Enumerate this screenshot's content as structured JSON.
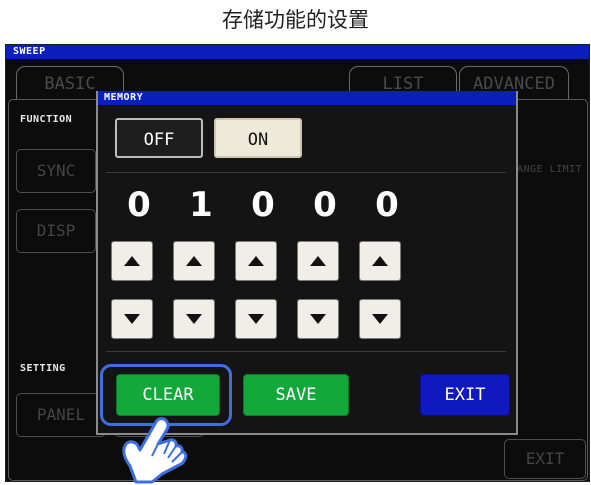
{
  "page_title": "存储功能的设置",
  "screen": {
    "title_bar": "SWEEP",
    "tabs": [
      "BASIC",
      "LIST",
      "ADVANCED"
    ],
    "section_labels": {
      "function": "FUNCTION",
      "setting": "SETTING"
    },
    "background_buttons": {
      "sync": "SYNC",
      "disp": "DISP",
      "panel": "PANEL",
      "range_limit": "ANGE LIMIT",
      "exit": "EXIT"
    }
  },
  "dialog": {
    "title": "MEMORY",
    "toggle": {
      "off_label": "OFF",
      "on_label": "ON",
      "selected": "OFF"
    },
    "digits": [
      "0",
      "1",
      "0",
      "0",
      "0"
    ],
    "buttons": {
      "clear": "CLEAR",
      "save": "SAVE",
      "exit": "EXIT"
    }
  },
  "colors": {
    "title_bar": "#0b1fbf",
    "green_button": "#12a83a",
    "exit_button": "#1018c0",
    "highlight": "#3f6ee0"
  },
  "icons": {
    "up": "arrow-up-icon",
    "down": "arrow-down-icon",
    "pointer": "pointing-hand-icon"
  }
}
